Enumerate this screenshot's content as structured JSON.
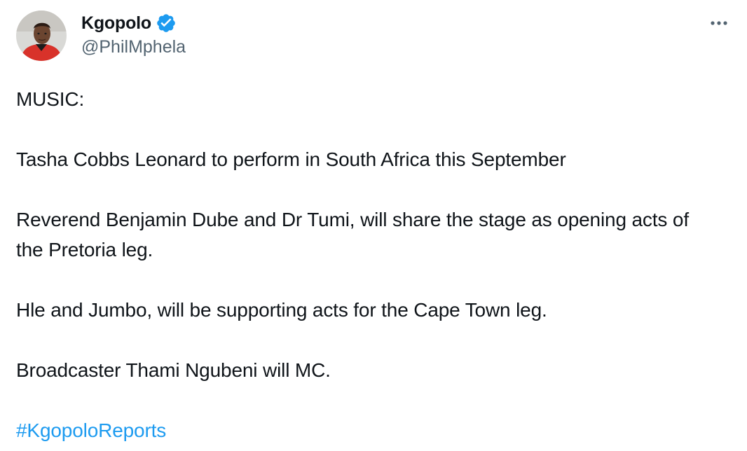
{
  "author": {
    "display_name": "Kgopolo",
    "handle": "@PhilMphela",
    "verified": true,
    "verified_color": "#1d9bf0"
  },
  "menu": {
    "icon": "more-horizontal-icon"
  },
  "tweet": {
    "lines": [
      "MUSIC:",
      "Tasha Cobbs Leonard to perform in South Africa this September",
      "Reverend Benjamin Dube and Dr Tumi, will share the stage as opening acts of the Pretoria leg.",
      "Hle and Jumbo, will be supporting acts for the Cape Town leg.",
      "Broadcaster Thami Ngubeni will MC."
    ],
    "hashtag": "#KgopoloReports",
    "hashtag_color": "#1d9bf0"
  }
}
